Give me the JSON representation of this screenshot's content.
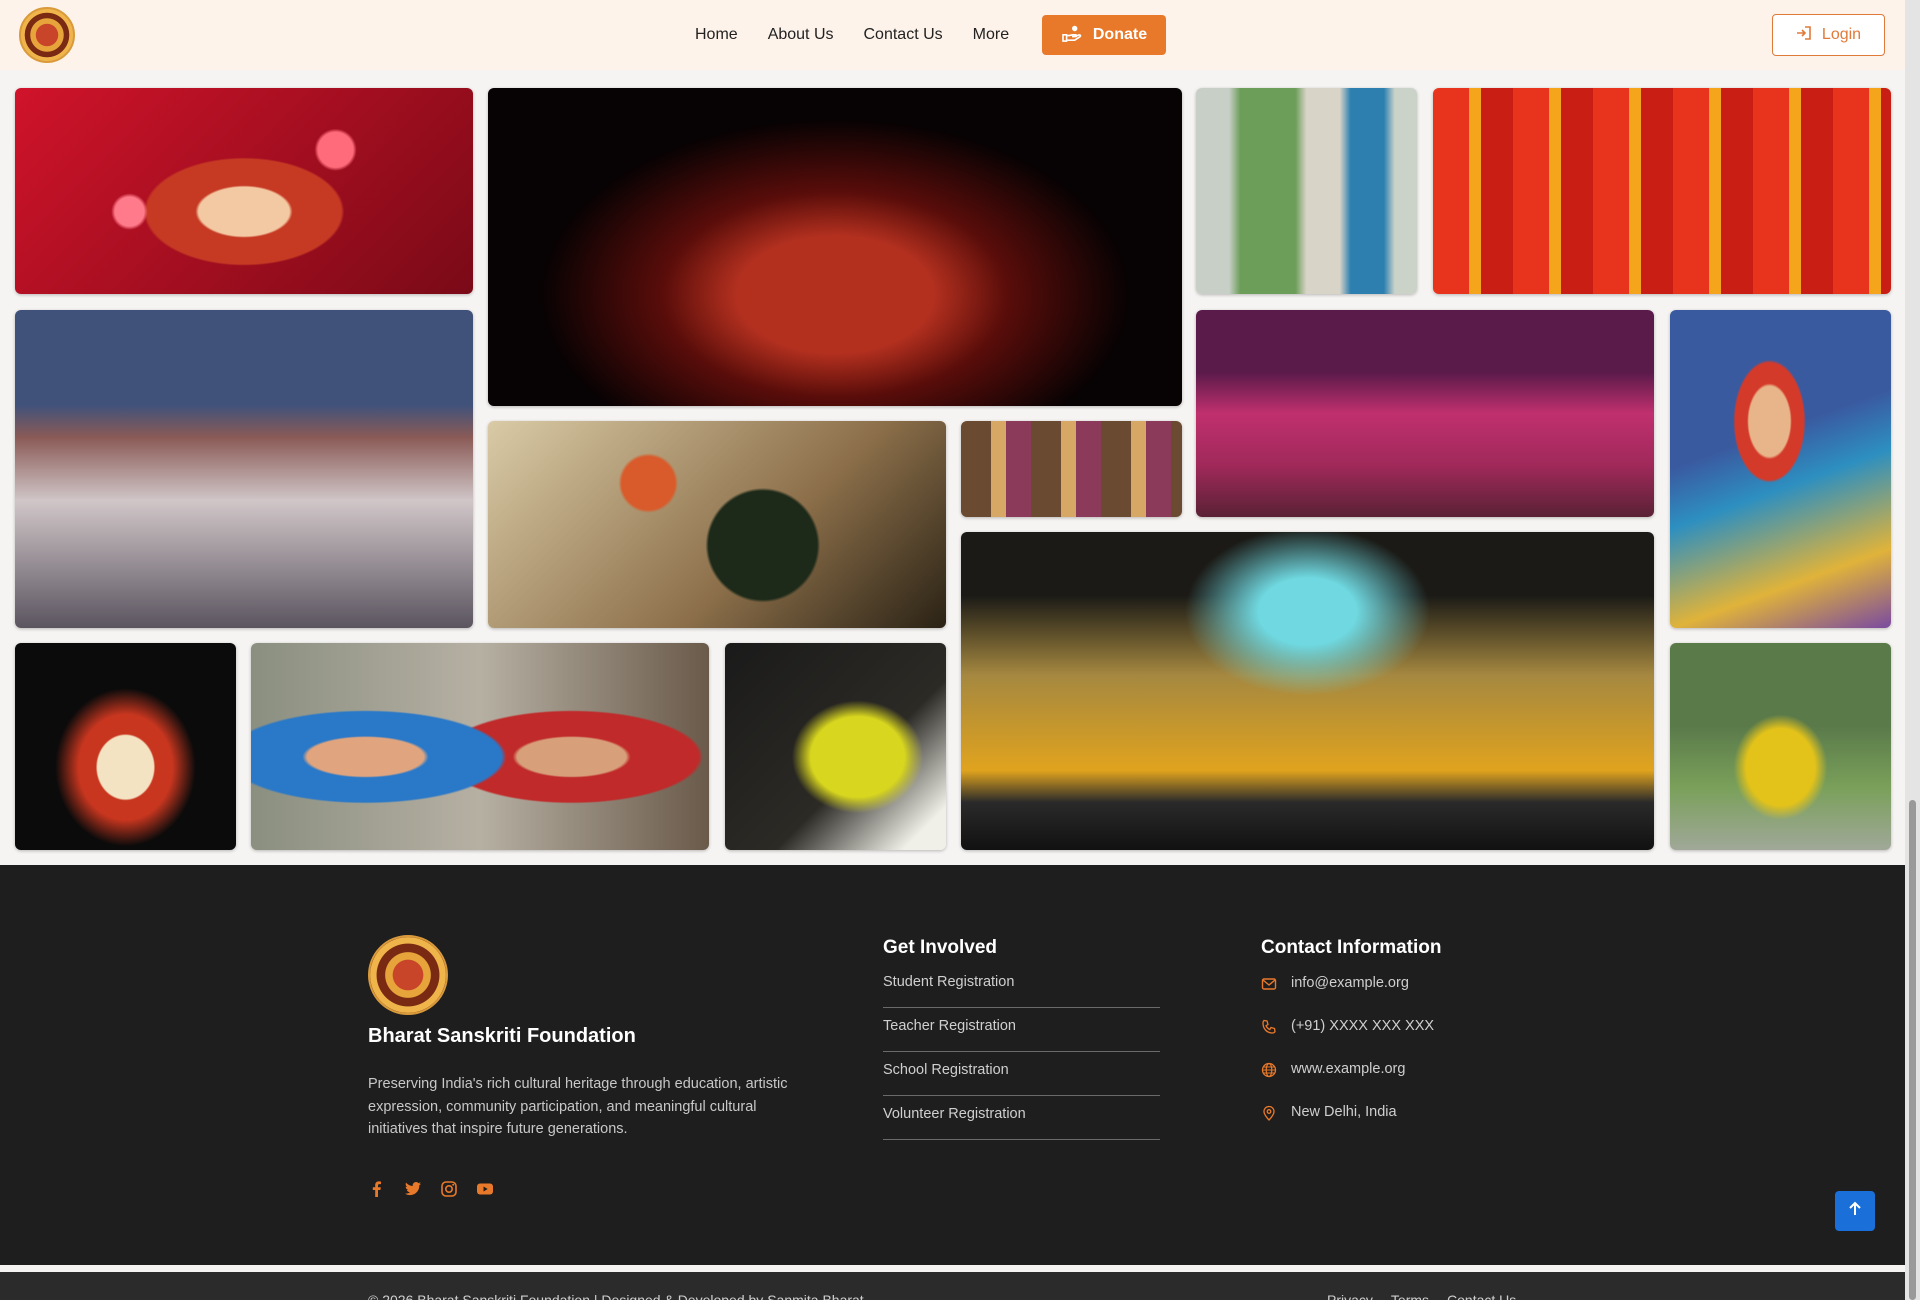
{
  "header": {
    "nav": [
      {
        "label": "Home"
      },
      {
        "label": "About Us"
      },
      {
        "label": "Contact Us"
      },
      {
        "label": "More"
      }
    ],
    "donate_label": "Donate",
    "login_label": "Login"
  },
  "footer": {
    "org_name": "Bharat Sanskriti Foundation",
    "description": "Preserving India's rich cultural heritage through education, artistic expression, community participation, and meaningful cultural initiatives that inspire future generations.",
    "social_icons": [
      "facebook-icon",
      "twitter-icon",
      "instagram-icon",
      "youtube-icon"
    ],
    "get_involved": {
      "heading": "Get Involved",
      "items": [
        {
          "label": "Student Registration"
        },
        {
          "label": "Teacher Registration"
        },
        {
          "label": "School Registration"
        },
        {
          "label": "Volunteer Registration"
        }
      ]
    },
    "contact": {
      "heading": "Contact Information",
      "email": "info@example.org",
      "phone": "(+91) XXXX XXX XXX",
      "website": "www.example.org",
      "location": "New Delhi, India"
    },
    "copyright": "© 2026 Bharat Sanskriti Foundation | Designed & Developed by Sanmita Bharat",
    "bottom_links": [
      {
        "label": "Privacy"
      },
      {
        "label": "Terms"
      },
      {
        "label": "Contact Us"
      }
    ]
  },
  "colors": {
    "accent": "#e8792b",
    "footer_bg": "#1e1e1e",
    "header_bg": "#fdf3ea",
    "back_to_top": "#1a6fd8"
  }
}
